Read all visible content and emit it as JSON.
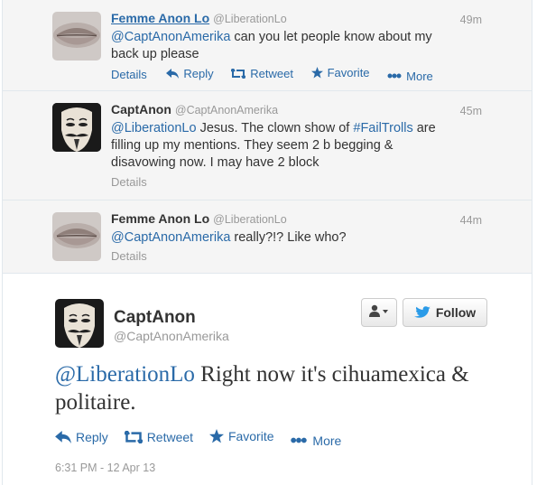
{
  "tweets": [
    {
      "name": "Femme Anon Lo",
      "handle": "@LiberationLo",
      "time": "49m",
      "mention": "@CaptAnonAmerika",
      "text_rest": " can you let people know about my back up please",
      "actions": {
        "details": "Details",
        "reply": "Reply",
        "retweet": "Retweet",
        "favorite": "Favorite",
        "more": "More"
      }
    },
    {
      "name": "CaptAnon",
      "handle": "@CaptAnonAmerika",
      "time": "45m",
      "mention": "@LiberationLo",
      "text_mid": " Jesus.  The clown show of ",
      "hashtag": "#FailTrolls",
      "text_rest": " are filling up my mentions.  They seem 2 b begging & disavowing now.  I may have 2 block",
      "details": "Details"
    },
    {
      "name": "Femme Anon Lo",
      "handle": "@LiberationLo",
      "time": "44m",
      "mention": "@CaptAnonAmerika",
      "text_rest": " really?!? Like who?",
      "details": "Details"
    }
  ],
  "focused": {
    "name": "CaptAnon",
    "handle": "@CaptAnonAmerika",
    "mention": "@LiberationLo",
    "text_rest": " Right now it's cihuamexica & politaire.",
    "follow_label": "Follow",
    "actions": {
      "reply": "Reply",
      "retweet": "Retweet",
      "favorite": "Favorite",
      "more": "More"
    },
    "date": "6:31 PM - 12 Apr 13"
  },
  "colors": {
    "link": "#2a6aa8",
    "muted": "#999999",
    "bird": "#2a9be8"
  }
}
